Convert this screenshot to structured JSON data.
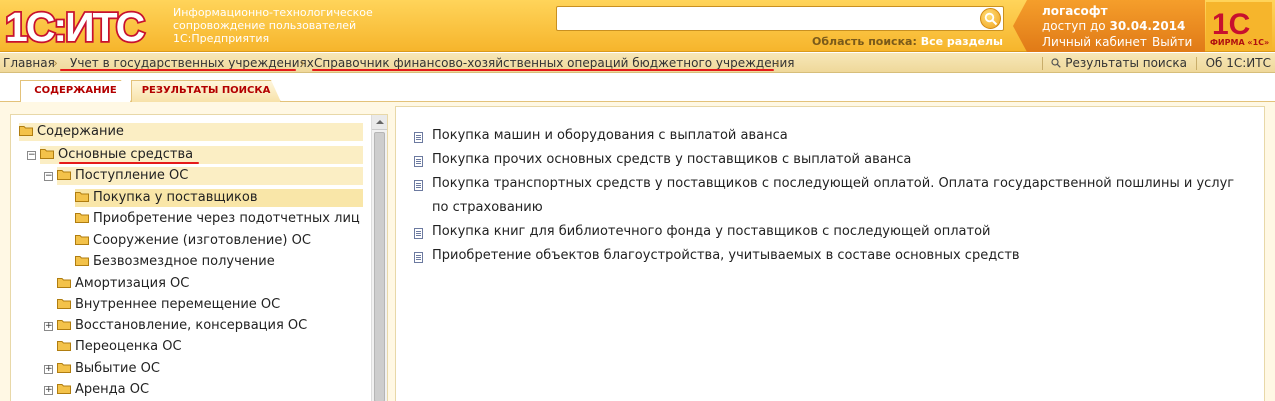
{
  "header": {
    "logo_text": "1С:ИТС",
    "logo_desc": [
      "Информационно-технологическое",
      "сопровождение пользователей",
      "1С:Предприятия"
    ],
    "search": {
      "value": "",
      "placeholder": ""
    },
    "search_scope_label": "Область поиска:",
    "search_scope_value": "Все разделы",
    "account": {
      "name": "логасофт",
      "access_prefix": "доступ до",
      "access_date": "30.04.2014",
      "cabinet": "Личный кабинет",
      "exit": "Выйти"
    },
    "firm_logo_text": "1С",
    "firm_caption": "ФИРМА «1С»"
  },
  "breadcrumb": [
    "Главная",
    "Учет в государственных учреждениях",
    "Справочник финансово-хозяйственных операций бюджетного учреждения"
  ],
  "top_links": {
    "search_results": "Результаты поиска",
    "about": "Об 1С:ИТС"
  },
  "tabs": [
    {
      "label": "СОДЕРЖАНИЕ",
      "active": true
    },
    {
      "label": "РЕЗУЛЬТАТЫ ПОИСКА",
      "active": false
    }
  ],
  "tree": [
    {
      "label": "Содержание",
      "level": 0
    },
    {
      "label": "Основные средства",
      "level": 1,
      "expanded": true
    },
    {
      "label": "Поступление ОС",
      "level": 2,
      "expanded": true
    },
    {
      "label": "Покупка у поставщиков",
      "level": 3,
      "selected": true
    },
    {
      "label": "Приобретение через подотчетных лиц",
      "level": 3
    },
    {
      "label": "Сооружение (изготовление) ОС",
      "level": 3
    },
    {
      "label": "Безвозмездное получение",
      "level": 3
    },
    {
      "label": "Амортизация ОС",
      "level": 2
    },
    {
      "label": "Внутреннее перемещение ОС",
      "level": 2
    },
    {
      "label": "Восстановление, консервация ОС",
      "level": 2,
      "expandable": true
    },
    {
      "label": "Переоценка ОС",
      "level": 2
    },
    {
      "label": "Выбытие ОС",
      "level": 2,
      "expandable": true
    },
    {
      "label": "Аренда ОС",
      "level": 2,
      "expandable": true
    }
  ],
  "documents": [
    {
      "label": "Покупка машин и оборудования с выплатой аванса"
    },
    {
      "label": "Покупка прочих основных средств у поставщиков с выплатой аванса"
    },
    {
      "label": "Покупка транспортных средств у поставщиков с последующей оплатой. Оплата государственной пошлины и услуг",
      "label2": "по страхованию"
    },
    {
      "label": "Покупка книг для библиотечного фонда у поставщиков с последующей оплатой"
    },
    {
      "label": "Приобретение объектов благоустройства, учитываемых в составе основных средств"
    }
  ],
  "colors": {
    "brand_red": "#c8102e",
    "header_yellow": "#f6b52c",
    "account_orange": "#e07a17"
  }
}
